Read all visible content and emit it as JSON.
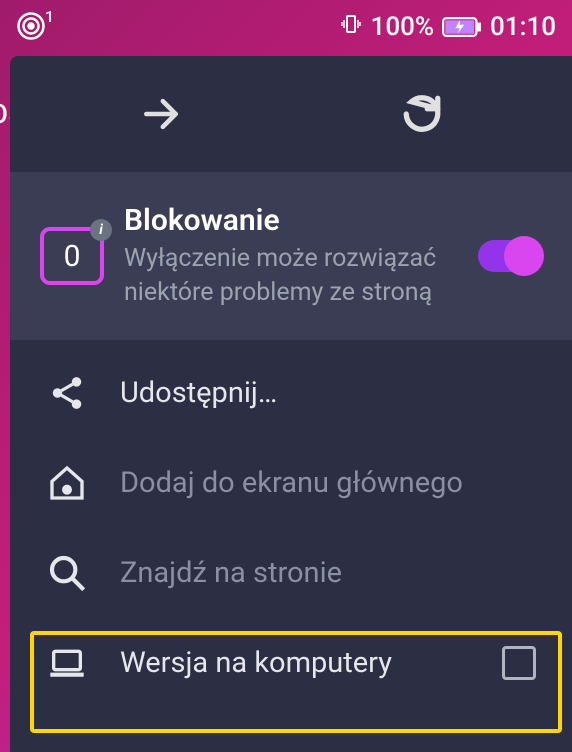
{
  "status": {
    "hotspot_badge": "1",
    "vibrate": "{}",
    "battery_pct": "100%",
    "time": "01:10"
  },
  "background_text": "ɔs",
  "nav": {
    "forward": "forward",
    "reload": "reload"
  },
  "blocking": {
    "count": "0",
    "title": "Blokowanie",
    "subtitle": "Wyłączenie może rozwiązać niektóre problemy ze stroną",
    "enabled": true
  },
  "menu": {
    "share": "Udostępnij…",
    "add_home": "Dodaj do ekranu głównego",
    "find": "Znajdź na stronie",
    "desktop": "Wersja na komputery",
    "desktop_checked": false
  }
}
